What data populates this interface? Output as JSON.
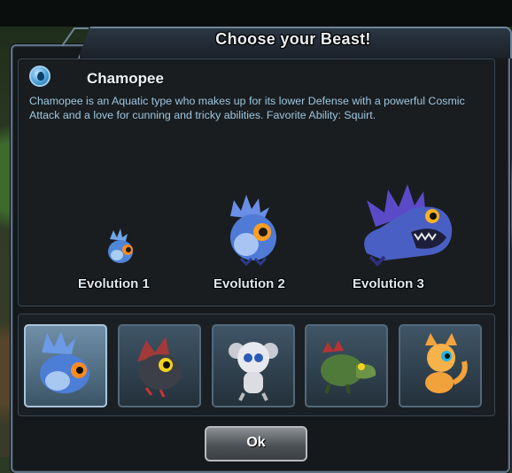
{
  "dialog": {
    "title": "Choose your Beast!"
  },
  "beast": {
    "name": "Chamopee",
    "type_icon": "water-drop-icon",
    "description": "Chamopee is an Aquatic type who makes up for its lower Defense with a powerful Cosmic Attack and a love for cunning and tricky abilities. Favorite Ability: Squirt."
  },
  "evolutions": [
    {
      "label": "Evolution 1"
    },
    {
      "label": "Evolution 2"
    },
    {
      "label": "Evolution 3"
    }
  ],
  "selector": {
    "slots": [
      {
        "icon": "blue-fish-beast-icon",
        "selected": true
      },
      {
        "icon": "dark-bird-beast-icon",
        "selected": false
      },
      {
        "icon": "white-monkey-beast-icon",
        "selected": false
      },
      {
        "icon": "green-lizard-beast-icon",
        "selected": false
      },
      {
        "icon": "orange-cat-beast-icon",
        "selected": false
      }
    ]
  },
  "buttons": {
    "ok_label": "Ok"
  },
  "colors": {
    "frame_border": "#5e7384",
    "description_text": "#9fc6e0",
    "selected_slot": "#6f8fa8"
  }
}
